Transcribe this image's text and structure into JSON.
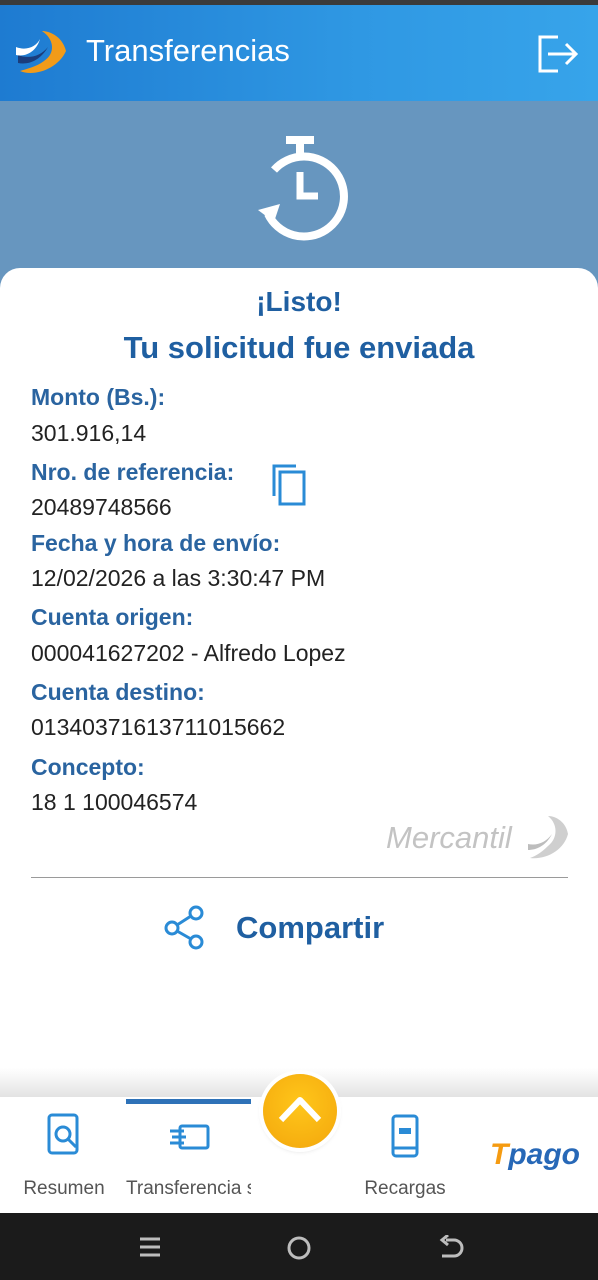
{
  "header": {
    "title": "Transferencias"
  },
  "confirmation": {
    "title": "¡Listo!",
    "subtitle": "Tu solicitud fue enviada"
  },
  "details": {
    "amount_label": "Monto (Bs.):",
    "amount_value": "301.916,14",
    "reference_label": "Nro. de referencia:",
    "reference_value": "20489748566",
    "datetime_label": "Fecha y hora de envío:",
    "datetime_value": "12/02/2026 a las 3:30:47 PM",
    "origin_label": "Cuenta origen:",
    "origin_value": "000041627202 - Alfredo Lopez",
    "destination_label": "Cuenta destino:",
    "destination_value": "01340371613711015662",
    "concept_label": "Concepto:",
    "concept_value": "18 1 100046574"
  },
  "brand_watermark": "Mercantil",
  "share": {
    "label": "Compartir"
  },
  "bottom_nav": {
    "items": [
      {
        "label": "Resumen",
        "icon": "search-document-icon"
      },
      {
        "label": "Transferencia\ns",
        "icon": "transfer-icon"
      },
      {
        "label": "Recargas",
        "icon": "phone-recharge-icon"
      }
    ],
    "center_icon": "chevron-up-icon",
    "partner_logo": {
      "t": "T",
      "rest": "pago"
    }
  },
  "icons": {
    "logout": "logout-icon",
    "timer": "stopwatch-history-icon",
    "copy": "copy-icon",
    "share": "share-icon"
  },
  "colors": {
    "primary": "#1f5fa1",
    "header": "#2f98e3",
    "accent": "#f3a60c"
  }
}
